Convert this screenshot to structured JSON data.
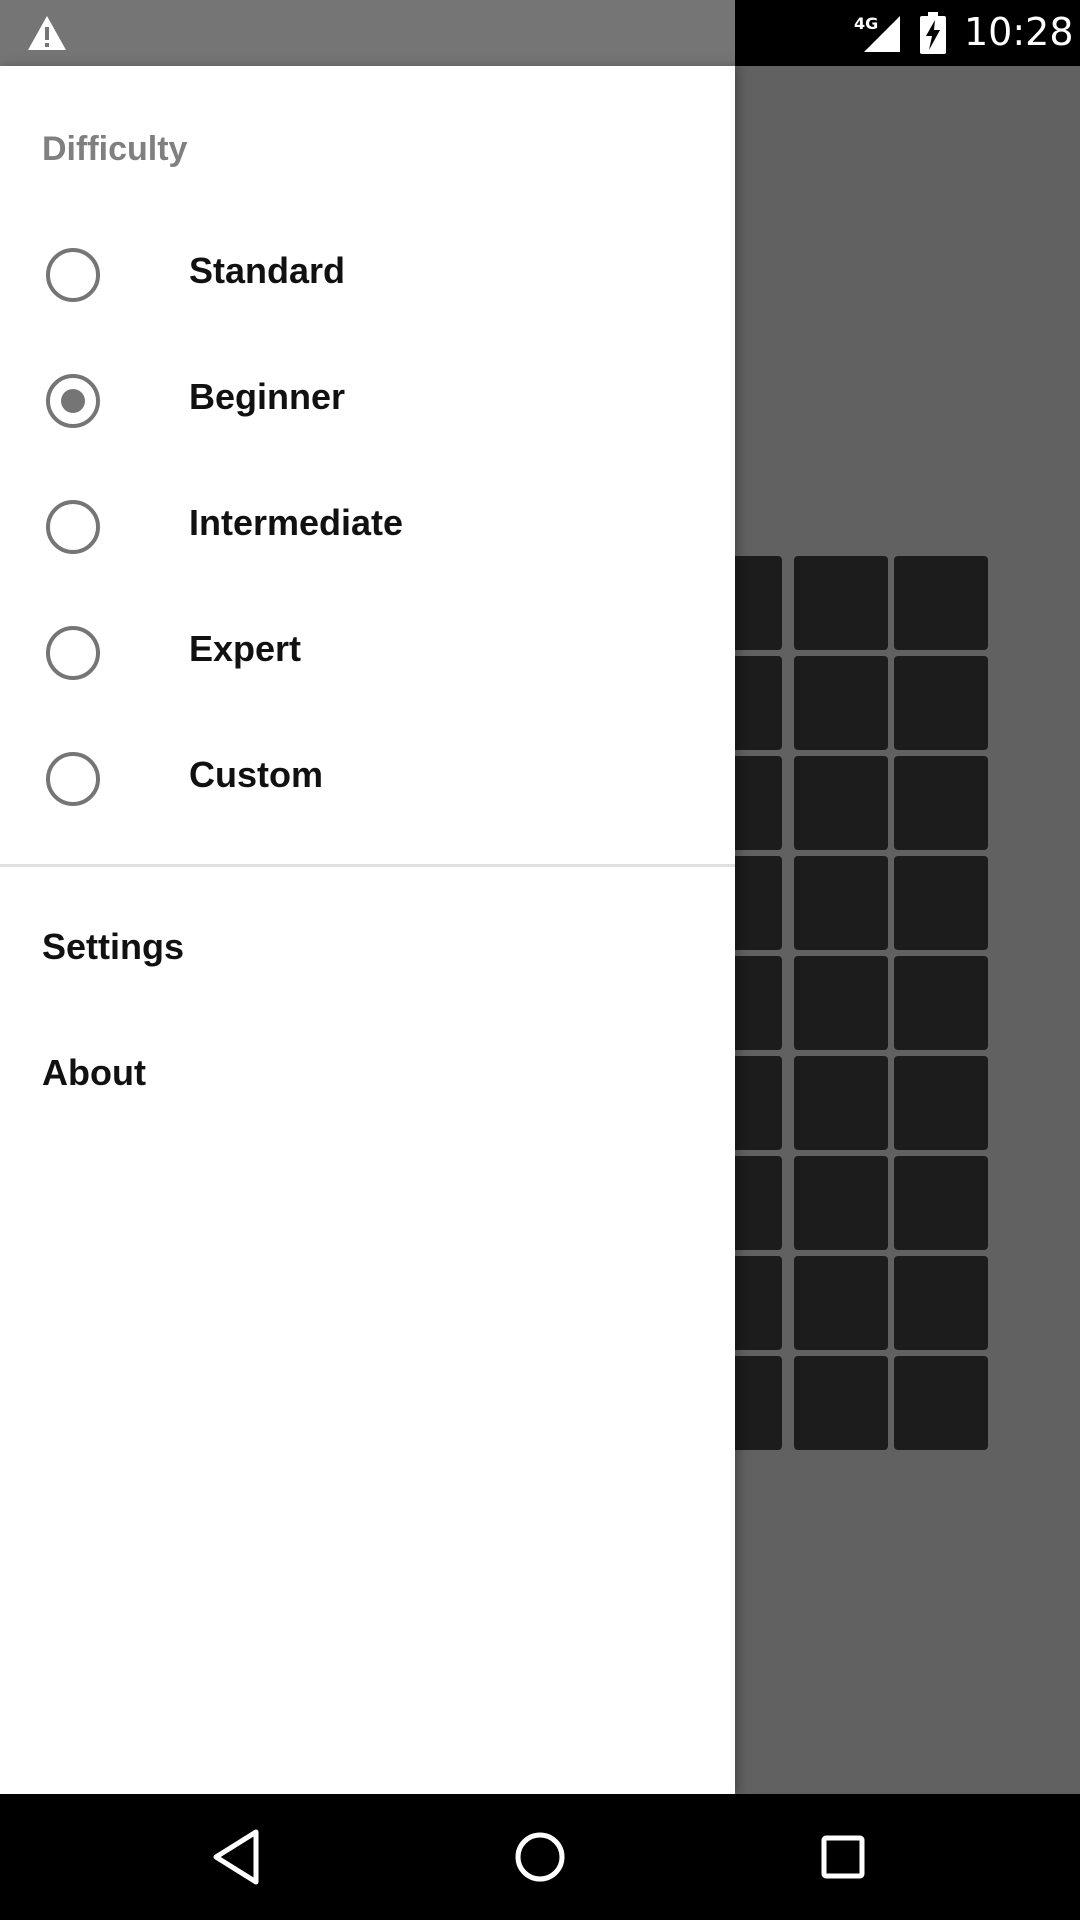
{
  "status_bar": {
    "network_type": "4G",
    "time": "10:28",
    "icons": [
      "warning-icon",
      "signal-icon",
      "battery-charging-icon"
    ]
  },
  "drawer": {
    "difficulty_title": "Difficulty",
    "options": [
      {
        "label": "Standard",
        "selected": false
      },
      {
        "label": "Beginner",
        "selected": true
      },
      {
        "label": "Intermediate",
        "selected": false
      },
      {
        "label": "Expert",
        "selected": false
      },
      {
        "label": "Custom",
        "selected": false
      }
    ],
    "menu": [
      {
        "label": "Settings"
      },
      {
        "label": "About"
      }
    ]
  },
  "nav_bar": {
    "icons": [
      "back-icon",
      "home-icon",
      "recents-icon"
    ]
  },
  "colors": {
    "scrim": "#616161",
    "cell": "#1c1c1c",
    "radio": "#757575",
    "section_title": "#808080"
  }
}
